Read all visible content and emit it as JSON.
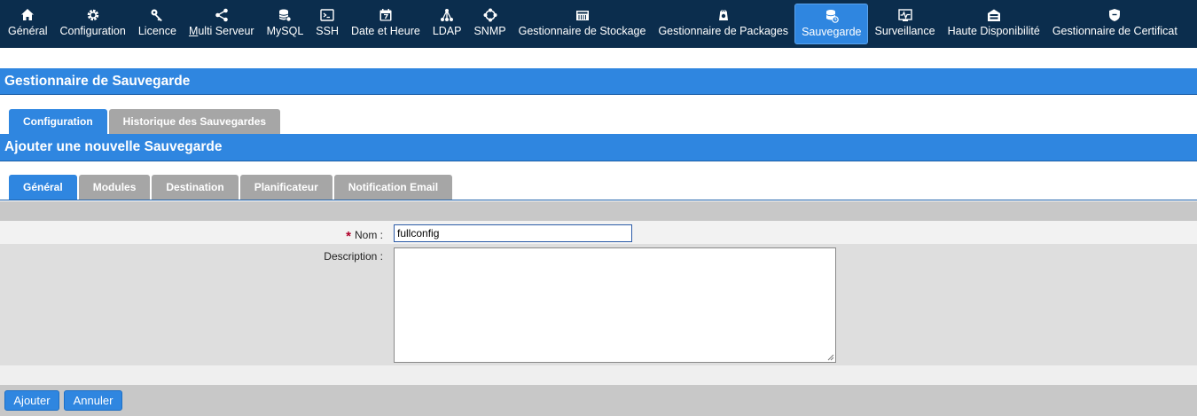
{
  "nav": {
    "items": [
      {
        "label": "Général",
        "icon": "home-icon"
      },
      {
        "label": "Configuration",
        "icon": "gear-icon"
      },
      {
        "label": "Licence",
        "icon": "key-icon"
      },
      {
        "label": "Multi Serveur",
        "icon": "share-icon"
      },
      {
        "label": "MySQL",
        "icon": "database-icon"
      },
      {
        "label": "SSH",
        "icon": "terminal-icon"
      },
      {
        "label": "Date et Heure",
        "icon": "calendar-icon"
      },
      {
        "label": "LDAP",
        "icon": "tree-icon"
      },
      {
        "label": "SNMP",
        "icon": "network-icon"
      },
      {
        "label": "Gestionnaire de Stockage",
        "icon": "storage-icon"
      },
      {
        "label": "Gestionnaire de Packages",
        "icon": "package-icon"
      },
      {
        "label": "Sauvegarde",
        "icon": "backup-database-icon"
      },
      {
        "label": "Surveillance",
        "icon": "monitor-icon"
      },
      {
        "label": "Haute Disponibilité",
        "icon": "ha-icon"
      },
      {
        "label": "Gestionnaire de Certificat",
        "icon": "certificate-icon"
      }
    ],
    "active": "Sauvegarde"
  },
  "header1": "Gestionnaire de Sauvegarde",
  "tabs_main": [
    {
      "label": "Configuration",
      "active": true
    },
    {
      "label": "Historique des Sauvegardes",
      "active": false
    }
  ],
  "header2": "Ajouter une nouvelle Sauvegarde",
  "tabs_sub": [
    {
      "label": "Général",
      "active": true
    },
    {
      "label": "Modules",
      "active": false
    },
    {
      "label": "Destination",
      "active": false
    },
    {
      "label": "Planificateur",
      "active": false
    },
    {
      "label": "Notification Email",
      "active": false
    }
  ],
  "form": {
    "required_mark": "*",
    "nom_label": "Nom  :",
    "nom_value": "fullconfig",
    "description_label": "Description  :",
    "description_value": ""
  },
  "buttons": {
    "add": "Ajouter",
    "cancel": "Annuler"
  },
  "colors": {
    "nav_bg": "#0b2d4d",
    "accent": "#2f86e0",
    "tab_inactive": "#a6a6a6",
    "required": "#b0002a"
  }
}
